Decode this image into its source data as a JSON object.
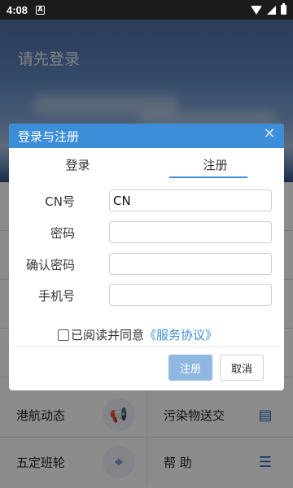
{
  "status_bar": {
    "time": "4:08",
    "notification_letter": "A"
  },
  "header": {
    "login_prompt": "请先登录"
  },
  "grid": {
    "rows": [
      {
        "left": {
          "label": "",
          "icon": ""
        },
        "right": {
          "label": "",
          "icon": ""
        }
      },
      {
        "left": {
          "label": "",
          "icon": ""
        },
        "right": {
          "label": "",
          "icon": ""
        }
      },
      {
        "left": {
          "label": "",
          "icon": ""
        },
        "right": {
          "label": "",
          "icon": ""
        }
      },
      {
        "left": {
          "label": "",
          "icon": ""
        },
        "right": {
          "label": "",
          "icon": ""
        }
      },
      {
        "left": {
          "label": "港航动态",
          "icon": "megaphone-icon"
        },
        "right": {
          "label": "污染物送交",
          "icon": "folder-icon"
        }
      },
      {
        "left": {
          "label": "五定班轮",
          "icon": "location-pin-icon"
        },
        "right": {
          "label": "帮 助",
          "icon": "document-icon"
        }
      }
    ]
  },
  "dialog": {
    "title": "登录与注册",
    "tabs": {
      "login": "登录",
      "register": "注册"
    },
    "fields": {
      "cn": {
        "label": "CN号",
        "value": "CN"
      },
      "password": {
        "label": "密码",
        "value": ""
      },
      "confirm_password": {
        "label": "确认密码",
        "value": ""
      },
      "phone": {
        "label": "手机号",
        "value": ""
      }
    },
    "agreement": {
      "text": "已阅读并同意",
      "link": "《服务协议》"
    },
    "buttons": {
      "register": "注册",
      "cancel": "取消"
    }
  },
  "colors": {
    "accent": "#3c8ed8",
    "register_button": "#8fb7e0"
  }
}
